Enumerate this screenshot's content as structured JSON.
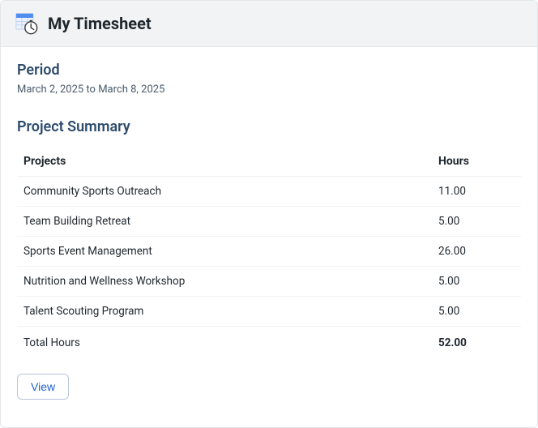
{
  "header": {
    "title": "My Timesheet",
    "icon_name": "timesheet-clock-icon"
  },
  "period": {
    "label": "Period",
    "text": "March 2, 2025 to March 8, 2025"
  },
  "summary": {
    "title": "Project Summary",
    "columns": {
      "projects": "Projects",
      "hours": "Hours"
    },
    "rows": [
      {
        "project": "Community Sports Outreach",
        "hours": "11.00"
      },
      {
        "project": "Team Building Retreat",
        "hours": "5.00"
      },
      {
        "project": "Sports Event Management",
        "hours": "26.00"
      },
      {
        "project": "Nutrition and Wellness Workshop",
        "hours": "5.00"
      },
      {
        "project": "Talent Scouting Program",
        "hours": "5.00"
      }
    ],
    "total": {
      "label": "Total Hours",
      "value": "52.00"
    }
  },
  "actions": {
    "view_label": "View"
  },
  "colors": {
    "accent_blue": "#2060d0",
    "heading_blue": "#2d4b6b",
    "icon_calendar": "#4f8ef0",
    "icon_clock_face": "#ffffff",
    "icon_clock_outline": "#3a3a3a"
  }
}
